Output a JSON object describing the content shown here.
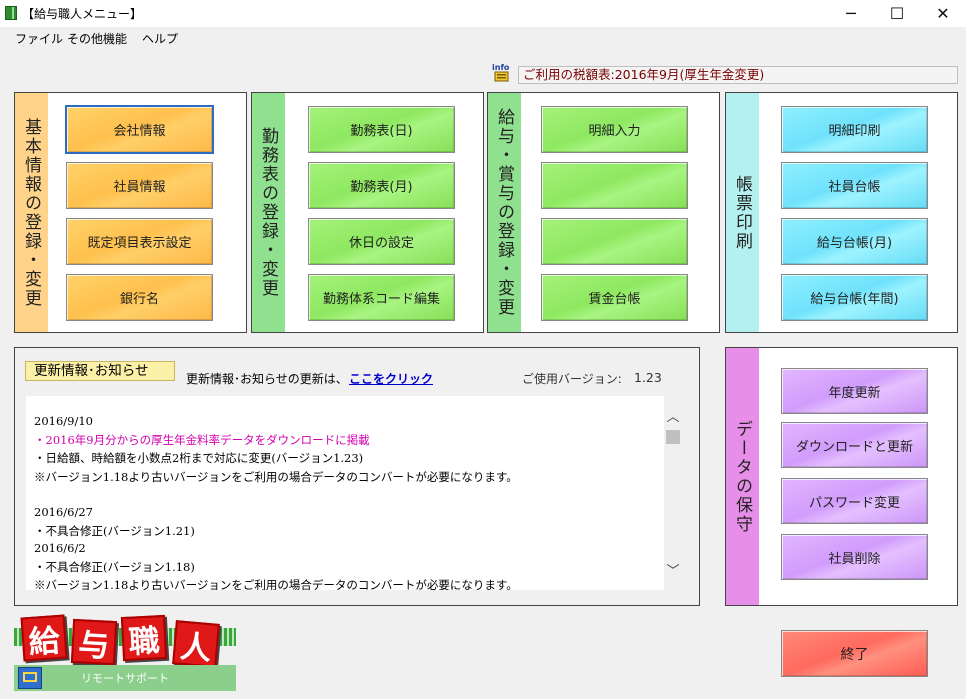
{
  "window": {
    "title": "【給与職人メニュー】",
    "minimize_glyph": "─",
    "maximize_glyph": "☐",
    "close_glyph": "✕"
  },
  "menu": [
    "ファイル",
    "その他機能",
    "ヘルプ"
  ],
  "info": {
    "icon": "info-icon",
    "label": "info",
    "tax_table": "ご利用の税額表:2016年9月(厚生年金変更)"
  },
  "sections": {
    "basic": {
      "title": "基本情報の登録・変更",
      "color": "#ffd38a",
      "buttons": [
        "会社情報",
        "社員情報",
        "既定項目表示設定",
        "銀行名"
      ]
    },
    "attendance": {
      "title": "勤務表の登録・変更",
      "color": "#8fe08f",
      "buttons": [
        "勤務表(日)",
        "勤務表(月)",
        "休日の設定",
        "勤務体系コード編集"
      ]
    },
    "payroll": {
      "title": "給与・賞与の登録・変更",
      "color": "#8fe08f",
      "buttons": [
        "明細入力",
        "",
        "",
        "賃金台帳"
      ]
    },
    "print": {
      "title": "帳票印刷",
      "color": "#b3f0ef",
      "buttons": [
        "明細印刷",
        "社員台帳",
        "給与台帳(月)",
        "給与台帳(年間)"
      ]
    },
    "maintenance": {
      "title": "データの保守",
      "color": "#e78ee8",
      "buttons": [
        "年度更新",
        "ダウンロードと更新",
        "パスワード変更",
        "社員削除"
      ]
    }
  },
  "news": {
    "header": "更新情報･お知らせ",
    "update_text": "更新情報･お知らせの更新は、",
    "link": "ここをクリック",
    "version_label": "ご使用バージョン:",
    "version": "1.23",
    "lines": [
      {
        "text": "2016/9/10",
        "color": "#000"
      },
      {
        "text": "・2016年9月分からの厚生年金料率データをダウンロードに掲載",
        "color": "#d400b0"
      },
      {
        "text": "・日給額、時給額を小数点2桁まで対応に変更(バージョン1.23)",
        "color": "#000"
      },
      {
        "text": "※バージョン1.18より古いバージョンをご利用の場合データのコンバートが必要になります。",
        "color": "#000"
      },
      {
        "text": "2016/6/27",
        "color": "#000"
      },
      {
        "text": "・不具合修正(バージョン1.21)",
        "color": "#000"
      },
      {
        "text": "2016/6/2",
        "color": "#000"
      },
      {
        "text": "・不具合修正(バージョン1.18)",
        "color": "#000"
      },
      {
        "text": "※バージョン1.18より古いバージョンをご利用の場合データのコンバートが必要になります。",
        "color": "#000"
      }
    ]
  },
  "logo": {
    "chars": [
      "給",
      "与",
      "職",
      "人"
    ]
  },
  "remote_support": "リモートサポート",
  "exit_button": "終了"
}
